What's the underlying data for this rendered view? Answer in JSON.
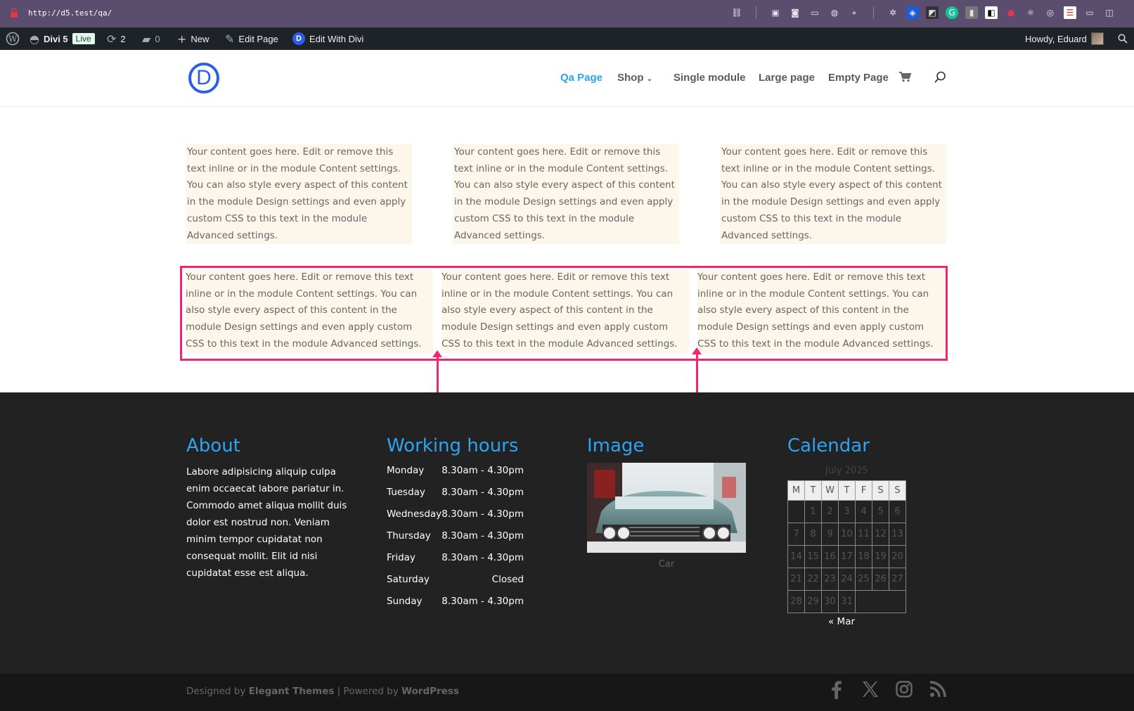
{
  "browser": {
    "url": "http://d5.test/qa/"
  },
  "admin_bar": {
    "site_name": "Divi 5",
    "live_badge": "Live",
    "updates_count": "2",
    "comments_count": "0",
    "new_label": "New",
    "edit_page_label": "Edit Page",
    "edit_with_divi_label": "Edit With Divi",
    "howdy": "Howdy, Eduard"
  },
  "header": {
    "logo_letter": "D",
    "nav": [
      {
        "label": "Qa Page",
        "active": true
      },
      {
        "label": "Shop",
        "has_dropdown": true
      },
      {
        "label": "Single module"
      },
      {
        "label": "Large page"
      },
      {
        "label": "Empty Page"
      }
    ]
  },
  "content": {
    "text": "Your content goes here. Edit or remove this text inline or in the module Content settings. You can also style every aspect of this content in the module Design settings and even apply custom CSS to this text in the module Advanced settings."
  },
  "footer": {
    "about": {
      "title": "About",
      "text": "Labore adipisicing aliquip culpa enim occaecat labore pariatur in. Commodo amet aliqua mollit duis dolor est nostrud non. Veniam minim tempor cupidatat non consequat mollit. Elit id nisi cupidatat esse est aliqua."
    },
    "hours": {
      "title": "Working hours",
      "rows": [
        {
          "day": "Monday",
          "time": "8.30am - 4.30pm"
        },
        {
          "day": "Tuesday",
          "time": "8.30am - 4.30pm"
        },
        {
          "day": "Wednesday",
          "time": "8.30am - 4.30pm"
        },
        {
          "day": "Thursday",
          "time": "8.30am - 4.30pm"
        },
        {
          "day": "Friday",
          "time": "8.30am - 4.30pm"
        },
        {
          "day": "Saturday",
          "time": "Closed"
        },
        {
          "day": "Sunday",
          "time": "8.30am - 4.30pm"
        }
      ]
    },
    "image": {
      "title": "Image",
      "caption": "Car"
    },
    "calendar": {
      "title": "Calendar",
      "caption": "July 2025",
      "weekdays": [
        "M",
        "T",
        "W",
        "T",
        "F",
        "S",
        "S"
      ],
      "weeks": [
        [
          "",
          "1",
          "2",
          "3",
          "4",
          "5",
          "6"
        ],
        [
          "7",
          "8",
          "9",
          "10",
          "11",
          "12",
          "13"
        ],
        [
          "14",
          "15",
          "16",
          "17",
          "18",
          "19",
          "20"
        ],
        [
          "21",
          "22",
          "23",
          "24",
          "25",
          "26",
          "27"
        ],
        [
          "28",
          "29",
          "30",
          "31",
          "",
          "",
          ""
        ]
      ],
      "prev_link": "« Mar"
    }
  },
  "bottom": {
    "designed_by": "Designed by",
    "elegant_themes": "Elegant Themes",
    "separator": "| Powered by",
    "wordpress": "WordPress"
  },
  "colors": {
    "accent": "#2ea3f2",
    "highlight": "#f0266f",
    "admin_bg": "#1d2327",
    "footer_bg": "#222222",
    "content_bg": "#fdf6ea"
  }
}
